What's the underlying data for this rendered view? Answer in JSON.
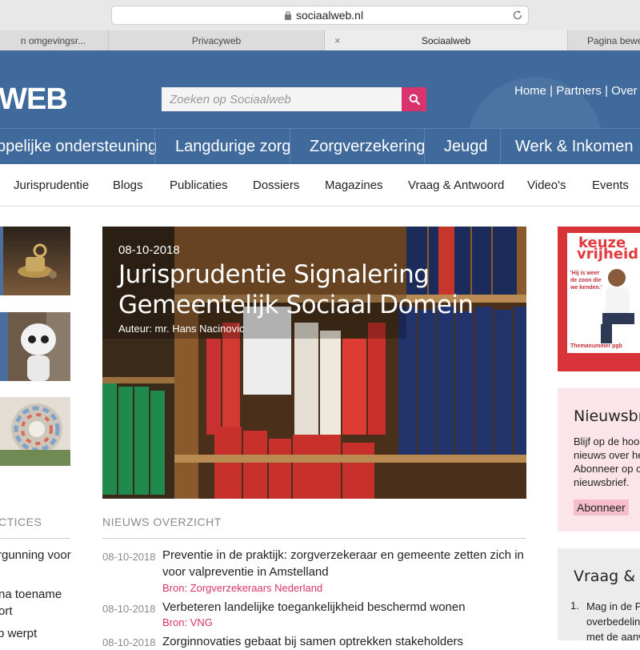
{
  "browser": {
    "url": "sociaalweb.nl",
    "tabs": [
      "n omgevingsr...",
      "Privacyweb",
      "Sociaalweb",
      "Pagina bewe"
    ],
    "close_glyph": "×"
  },
  "header": {
    "logo": "LWEB",
    "search_placeholder": "Zoeken op Sociaalweb",
    "top_links": "Home | Partners | Over S"
  },
  "main_nav": [
    "ppelijke ondersteuning",
    "Langdurige zorg",
    "Zorgverzekering",
    "Jeugd",
    "Werk & Inkomen"
  ],
  "sub_nav": [
    "Jurisprudentie",
    "Blogs",
    "Publicaties",
    "Dossiers",
    "Magazines",
    "Vraag & Antwoord",
    "Video's",
    "Events"
  ],
  "left_column": {
    "heading": "CTICES",
    "items": [
      "rgunning voor",
      "na toename",
      "ort",
      "p werpt"
    ]
  },
  "hero": {
    "date": "08-10-2018",
    "title_line1": "Jurisprudentie Signalering",
    "title_line2": "Gemeentelijk Sociaal Domein",
    "author": "Auteur: mr. Hans Nacinovic"
  },
  "news": {
    "heading": "NIEUWS OVERZICHT",
    "items": [
      {
        "date": "08-10-2018",
        "title": "Preventie in de praktijk: zorgverzekeraar en gemeente zetten zich in voor valpreventie in Amstelland",
        "source": "Bron: Zorgverzekeraars Nederland"
      },
      {
        "date": "08-10-2018",
        "title": "Verbeteren landelijke toegankelijkheid beschermd wonen",
        "source": "Bron: VNG"
      },
      {
        "date": "08-10-2018",
        "title": "Zorginnovaties gebaat bij samen optrekken stakeholders",
        "source": ""
      }
    ]
  },
  "magazine": {
    "title_line1": "keuze",
    "title_line2": "vrijheid",
    "quote": "'Hij is weer de zoon die we kenden.'",
    "caption": "Themanummer pgb"
  },
  "nieuwsbrief": {
    "title": "Nieuwsbrief",
    "text_lines": [
      "Blijf op de hoogte",
      "nieuws over het",
      "Abonneer op onze",
      "nieuwsbrief."
    ],
    "button": "Abonneer"
  },
  "vraag": {
    "title": "Vraag & Antwoord",
    "number": "1.",
    "text_lines": [
      "Mag in de P",
      "overbedelin",
      "met de aanv"
    ]
  },
  "colors": {
    "header_blue": "#3f6a9b",
    "accent_pink": "#d8336d",
    "source_pink": "#d6336c",
    "nieuwsbrief_bg": "#fbe4ea",
    "magazine_red": "#d9333a"
  }
}
